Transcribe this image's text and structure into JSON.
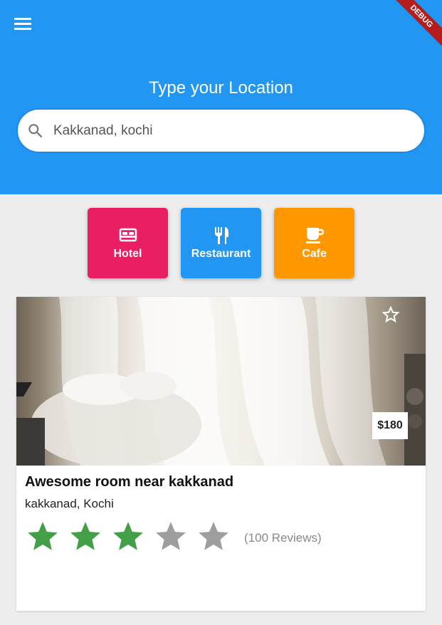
{
  "header": {
    "menu_icon": "menu-icon",
    "debug_label": "DEBUG",
    "title": "Type your Location",
    "accent": "#2196f3"
  },
  "search": {
    "icon": "search-icon",
    "value": "Kakkanad, kochi"
  },
  "categories": [
    {
      "label": "Hotel",
      "icon": "bed-icon",
      "color": "#e91e63"
    },
    {
      "label": "Restaurant",
      "icon": "restaurant-icon",
      "color": "#2196f3"
    },
    {
      "label": "Cafe",
      "icon": "coffee-icon",
      "color": "#ff9800"
    }
  ],
  "listing": {
    "title": "Awesome room near kakkanad",
    "location": "kakkanad, Kochi",
    "price": "$180",
    "favorite_icon": "star-outline-icon",
    "rating": 3,
    "rating_max": 5,
    "reviews": "(100 Reviews)",
    "star_filled_color": "#43a047",
    "star_empty_color": "#9e9e9e"
  }
}
